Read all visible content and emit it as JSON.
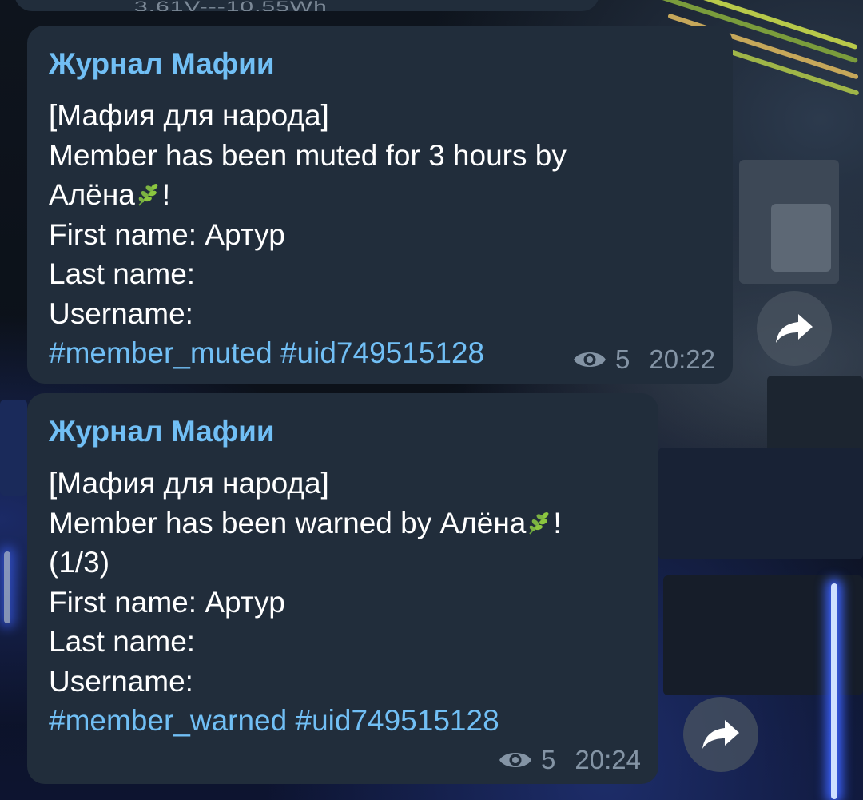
{
  "partial_message": {
    "text": "3.61V---10.55Wh"
  },
  "messages": [
    {
      "sender": "Журнал Мафии",
      "lines": [
        "[Мафия для народа]",
        "Member has been muted for 3 hours by",
        "Алёна",
        "First name: Артур",
        "Last name:",
        "Username:"
      ],
      "emoji_suffix": "!",
      "hashtags": [
        "#member_muted",
        "#uid749515128"
      ],
      "views": "5",
      "time": "20:22"
    },
    {
      "sender": "Журнал Мафии",
      "lines": [
        "[Мафия для народа]",
        "Member has been warned by Алёна",
        "(1/3)",
        "First name: Артур",
        "Last name:",
        "Username:"
      ],
      "emoji_suffix": "!",
      "hashtags": [
        "#member_warned",
        "#uid749515128"
      ],
      "views": "5",
      "time": "20:24"
    }
  ],
  "icons": {
    "views": "eye-icon",
    "share": "share-icon",
    "emoji": "herb-leaf-icon"
  },
  "colors": {
    "bubble": "#212d3b",
    "sender": "#71bff5",
    "hashtag": "#71bff5",
    "meta": "#8494a5"
  }
}
